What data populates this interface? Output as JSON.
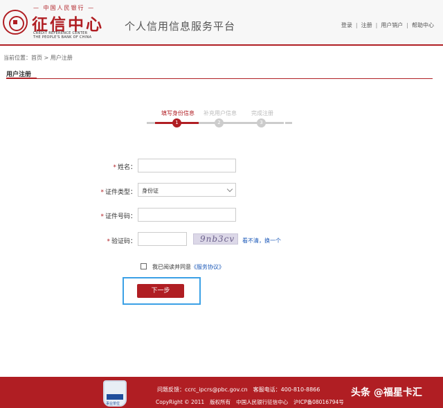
{
  "header": {
    "logo_top": "— 中国人民银行 —",
    "logo_main": "征信中心",
    "logo_en_line1": "CREDIT REFERENCE CENTER",
    "logo_en_line2": "THE PEOPLE'S BANK OF CHINA",
    "site_title": "个人信用信息服务平台",
    "links": [
      "登录",
      "注册",
      "用户销户",
      "帮助中心"
    ]
  },
  "breadcrumb": {
    "prefix": "当前位置：",
    "home": "首页",
    "separator": " > ",
    "current": "用户注册"
  },
  "section_title": "用户注册",
  "steps": [
    {
      "label": "填写身份信息",
      "number": "1",
      "active": true
    },
    {
      "label": "补充用户信息",
      "number": "2",
      "active": false
    },
    {
      "label": "完成注册",
      "number": "3",
      "active": false
    }
  ],
  "form": {
    "required_mark": "*",
    "name_label": "姓名：",
    "name_value": "",
    "id_type_label": "证件类型：",
    "id_type_value": "身份证",
    "id_number_label": "证件号码：",
    "id_number_value": "",
    "captcha_label": "验证码：",
    "captcha_value": "",
    "captcha_image_text": "9nb3cv",
    "captcha_refresh": "看不清，换一个",
    "agree_text": "我已阅读并同意",
    "agree_link": "《服务协议》",
    "next_button": "下一步"
  },
  "footer": {
    "badge_text": "事业单位",
    "feedback_label": "问题反馈：",
    "feedback_email": "ccrc_ipcrs@pbc.gov.cn",
    "phone_label": "客服电话：",
    "phone": "400-810-8866",
    "copyright": "CopyRight © 2011",
    "rights": "版权所有",
    "org": "中国人民银行征信中心",
    "icp": "沪ICP备08016794号"
  },
  "watermark": "头条 @福星卡汇",
  "colors": {
    "brand_red": "#b01e23",
    "link_blue": "#1b58b8",
    "highlight_frame": "#3aa0e6"
  }
}
